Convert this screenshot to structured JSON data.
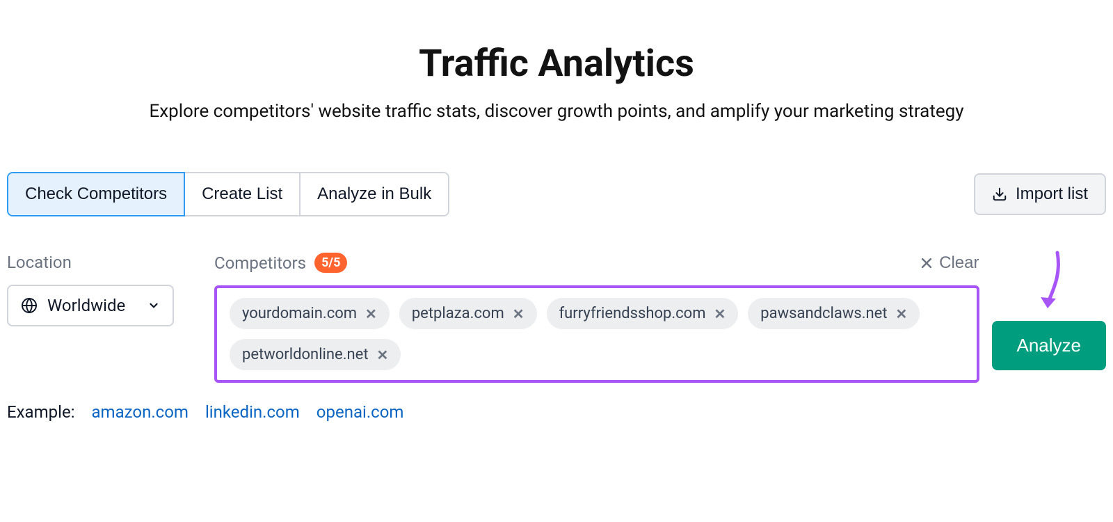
{
  "header": {
    "title": "Traffic Analytics",
    "subtitle": "Explore competitors' website traffic stats, discover growth points, and amplify your marketing strategy"
  },
  "tabs": [
    {
      "label": "Check Competitors",
      "active": true
    },
    {
      "label": "Create List",
      "active": false
    },
    {
      "label": "Analyze in Bulk",
      "active": false
    }
  ],
  "import_button": "Import list",
  "location": {
    "label": "Location",
    "value": "Worldwide"
  },
  "competitors": {
    "label": "Competitors",
    "badge": "5/5",
    "clear_label": "Clear",
    "chips": [
      "yourdomain.com",
      "petplaza.com",
      "furryfriendsshop.com",
      "pawsandclaws.net",
      "petworldonline.net"
    ]
  },
  "analyze_button": "Analyze",
  "example": {
    "label": "Example:",
    "links": [
      "amazon.com",
      "linkedin.com",
      "openai.com"
    ]
  },
  "colors": {
    "accent_purple": "#a855f7",
    "accent_green": "#009e7f",
    "badge_orange": "#ff642f",
    "tab_active_bg": "#e6f1fe",
    "link_blue": "#0b66c3"
  }
}
